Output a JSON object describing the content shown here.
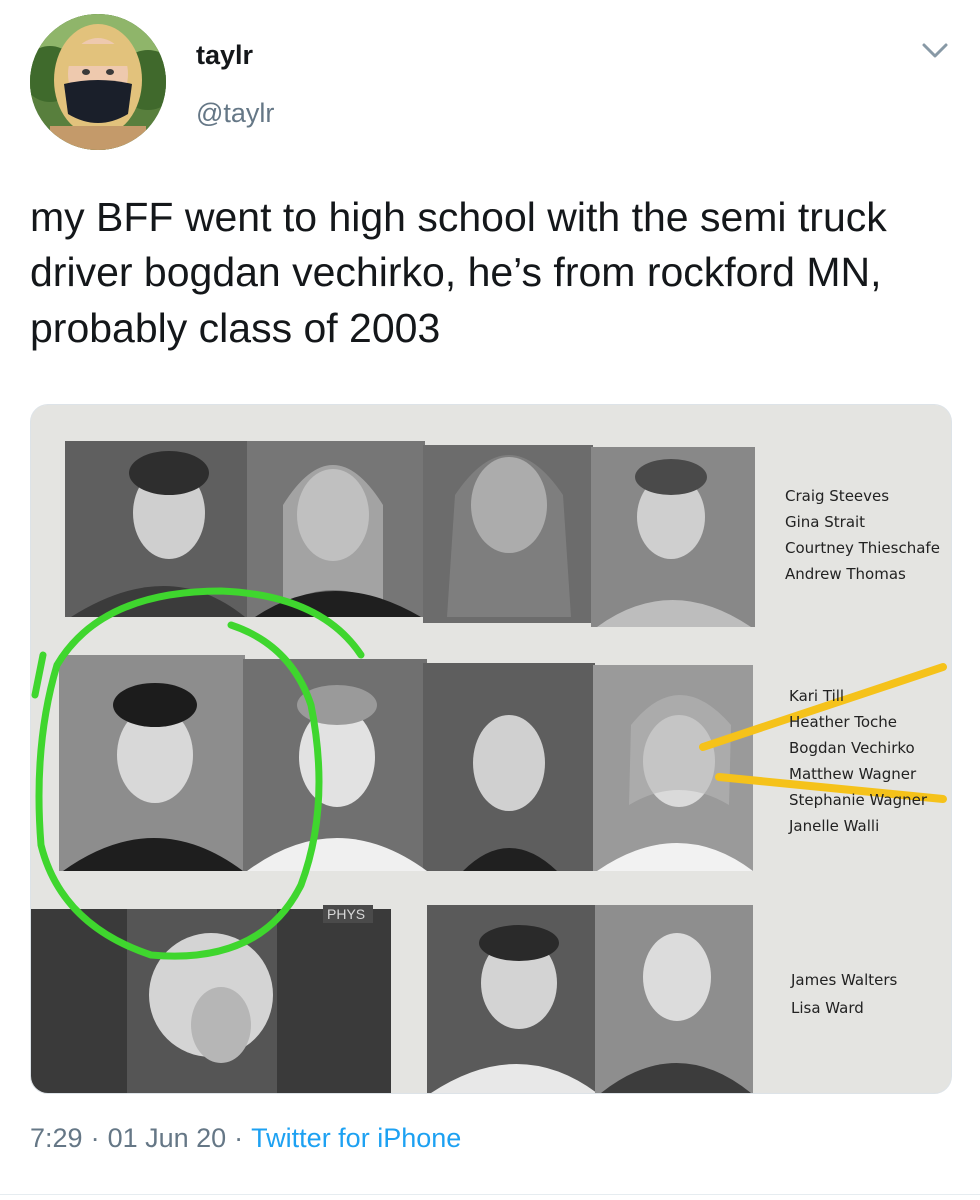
{
  "tweet": {
    "display_name": "taylr",
    "handle": "@taylr",
    "text": "my BFF went to high school with the semi truck driver bogdan vechirko, he’s from rockford MN, probably class of 2003",
    "time": "7:29",
    "date": "01 Jun 20",
    "source": "Twitter for iPhone"
  },
  "yearbook": {
    "group1": [
      "Craig Steeves",
      "Gina Strait",
      "Courtney Thieschafe",
      "Andrew Thomas"
    ],
    "group2": [
      "Kari Till",
      "Heather Toche",
      "Bogdan Vechirko",
      "Matthew Wagner",
      "Stephanie Wagner",
      "Janelle Walli"
    ],
    "group3": [
      "James Walters",
      "Lisa Ward"
    ],
    "sign": "PHYS"
  },
  "colors": {
    "link": "#1da1f2",
    "muted": "#657786",
    "highlight_circle": "#3fd62e",
    "highlight_lines": "#f5c21a"
  },
  "icons": {
    "menu": "chevron-down-icon"
  }
}
